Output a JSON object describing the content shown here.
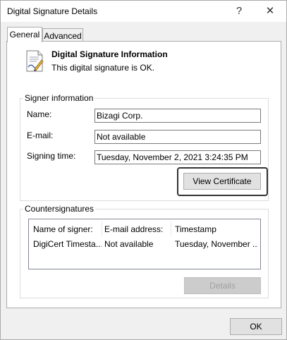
{
  "window": {
    "title": "Digital Signature Details",
    "help_glyph": "?",
    "close_glyph": "✕"
  },
  "tabs": [
    {
      "label": "General",
      "active": true
    },
    {
      "label": "Advanced",
      "active": false
    }
  ],
  "header": {
    "heading": "Digital Signature Information",
    "status": "This digital signature is OK.",
    "icon": "certificate-icon"
  },
  "signer": {
    "legend": "Signer information",
    "name_label": "Name:",
    "name_value": "Bizagi Corp.",
    "email_label": "E-mail:",
    "email_value": "Not available",
    "time_label": "Signing time:",
    "time_value": "Tuesday, November 2, 2021 3:24:35 PM",
    "view_certificate_label": "View Certificate"
  },
  "countersignatures": {
    "legend": "Countersignatures",
    "columns": [
      "Name of signer:",
      "E-mail address:",
      "Timestamp"
    ],
    "rows": [
      [
        "DigiCert Timesta...",
        "Not available",
        "Tuesday, November ..."
      ]
    ],
    "details_label": "Details"
  },
  "footer": {
    "ok_label": "OK"
  }
}
